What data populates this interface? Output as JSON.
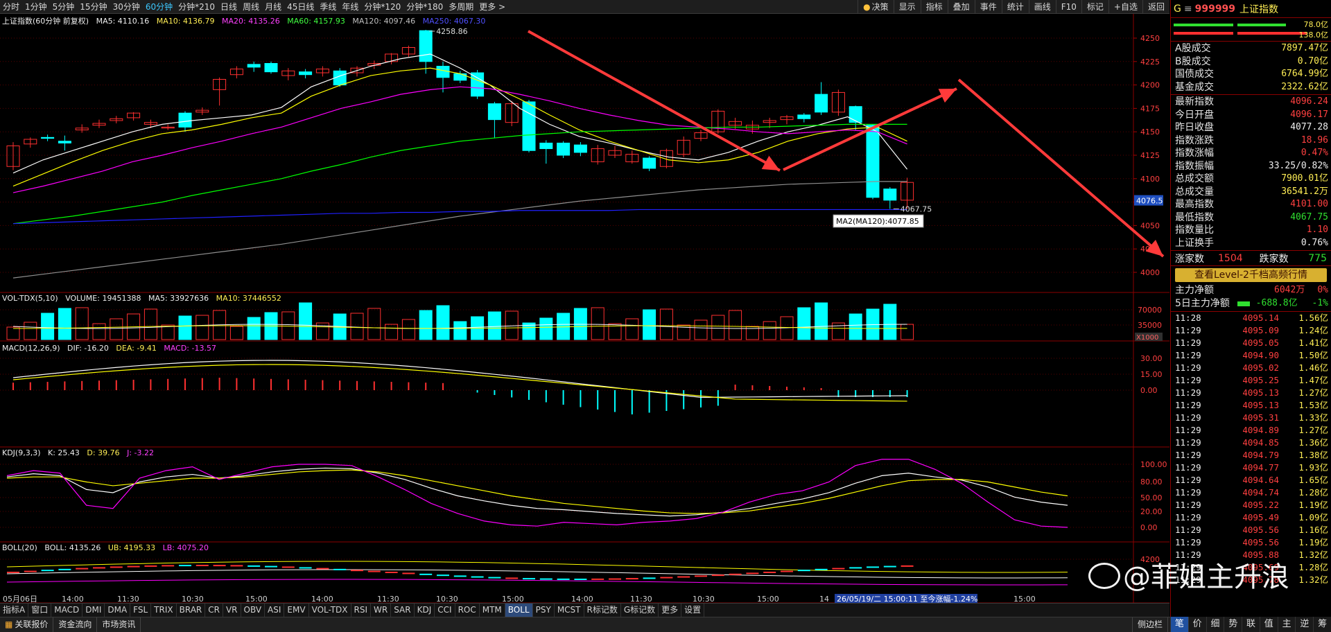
{
  "toolbar": {
    "periods": [
      "分时",
      "1分钟",
      "5分钟",
      "15分钟",
      "30分钟",
      "60分钟",
      "分钟*210",
      "日线",
      "周线",
      "月线",
      "45日线",
      "季线",
      "年线",
      "分钟*120",
      "分钟*180",
      "多周期",
      "更多 >"
    ],
    "active_period": "60分钟",
    "buttons": [
      "决策",
      "显示",
      "指标",
      "叠加",
      "事件",
      "统计",
      "画线",
      "F10",
      "标记",
      "+自选",
      "返回"
    ]
  },
  "main_panel": {
    "title": "上证指数(60分钟 前复权)",
    "ma5": "MA5: 4110.16",
    "ma10": "MA10: 4136.79",
    "ma20": "MA20: 4135.26",
    "ma60": "MA60: 4157.93",
    "ma120": "MA120: 4097.46",
    "ma250": "MA250: 4067.30",
    "high_mark": "4258.86",
    "low_mark": "4067.75",
    "tooltip": "MA2(MA120):4077.85",
    "cursor_price": "4076.5",
    "y_ticks": [
      "4250",
      "4225",
      "4200",
      "4175",
      "4150",
      "4125",
      "4100",
      "4075",
      "4050",
      "4025",
      "4000"
    ]
  },
  "vol_panel": {
    "title": "VOL-TDX(5,10)",
    "volume": "VOLUME: 19451388",
    "ma5": "MA5: 33927636",
    "ma10": "MA10: 37446552",
    "y_ticks": [
      "70000",
      "35000"
    ],
    "unit": "X1000"
  },
  "macd_panel": {
    "title": "MACD(12,26,9)",
    "dif": "DIF: -16.20",
    "dea": "DEA: -9.41",
    "macd": "MACD: -13.57",
    "y_ticks": [
      "30.00",
      "15.00",
      "0.00"
    ]
  },
  "kdj_panel": {
    "title": "KDJ(9,3,3)",
    "k": "K: 25.43",
    "d": "D: 39.76",
    "j": "J: -3.22",
    "y_ticks": [
      "100.00",
      "80.00",
      "50.00",
      "20.00",
      "0.00"
    ]
  },
  "boll_panel": {
    "title": "BOLL(20)",
    "boll": "BOLL: 4135.26",
    "ub": "UB: 4195.33",
    "lb": "LB: 4075.20",
    "y_ticks": [
      "4200"
    ]
  },
  "x_axis": {
    "labels": [
      "05月06日",
      "14:00",
      "11:30",
      "10:30",
      "15:00",
      "14:00",
      "11:30",
      "10:30",
      "15:00",
      "14:00",
      "11:30",
      "10:30",
      "15:00",
      "14"
    ],
    "cursor_info": "26/05/19/二 15:00:11 至今涨幅-1.24%",
    "last_label": "15:00"
  },
  "indicators": [
    "指标A",
    "窗口",
    "MACD",
    "DMI",
    "DMA",
    "FSL",
    "TRIX",
    "BRAR",
    "CR",
    "VR",
    "OBV",
    "ASI",
    "EMV",
    "VOL-TDX",
    "RSI",
    "WR",
    "SAR",
    "KDJ",
    "CCI",
    "ROC",
    "MTM",
    "BOLL",
    "PSY",
    "MCST",
    "R标记数",
    "G标记数",
    "更多",
    "设置"
  ],
  "active_indicator": "BOLL",
  "status_bar": [
    "关联报价",
    "资金流向",
    "市场资讯"
  ],
  "side_label": "侧边栏",
  "right_panel": {
    "code": "999999",
    "name": "上证指数",
    "marker": "G",
    "bar_top": "78.0亿",
    "bar_bottom": "138.0亿",
    "turnover": [
      {
        "k": "A股成交",
        "v": "7897.47亿"
      },
      {
        "k": "B股成交",
        "v": "0.70亿"
      },
      {
        "k": "国债成交",
        "v": "6764.99亿"
      },
      {
        "k": "基金成交",
        "v": "2322.62亿"
      }
    ],
    "stats": [
      {
        "k": "最新指数",
        "v": "4096.24",
        "c": "red"
      },
      {
        "k": "今日开盘",
        "v": "4096.17",
        "c": "red"
      },
      {
        "k": "昨日收盘",
        "v": "4077.28",
        "c": "white"
      },
      {
        "k": "指数涨跌",
        "v": "18.96",
        "c": "red"
      },
      {
        "k": "指数涨幅",
        "v": "0.47%",
        "c": "red"
      },
      {
        "k": "指数振幅",
        "v": "33.25/0.82%",
        "c": "white"
      },
      {
        "k": "总成交额",
        "v": "7900.01亿",
        "c": "yellow"
      },
      {
        "k": "总成交量",
        "v": "36541.2万",
        "c": "yellow"
      },
      {
        "k": "最高指数",
        "v": "4101.00",
        "c": "red"
      },
      {
        "k": "最低指数",
        "v": "4067.75",
        "c": "green"
      },
      {
        "k": "指数量比",
        "v": "1.10",
        "c": "red"
      },
      {
        "k": "上证换手",
        "v": "0.76%",
        "c": "white"
      }
    ],
    "rise_label": "涨家数",
    "rise_value": "1504",
    "fall_label": "跌家数",
    "fall_value": "775",
    "level2": "查看Level-2千档高频行情",
    "main_net_label": "主力净额",
    "main_net_value": "6042万",
    "main_net_pct": "0%",
    "five_day_label": "5日主力净额",
    "five_day_value": "-688.8亿",
    "five_day_pct": "-1%",
    "ticks": [
      {
        "t": "11:28",
        "p": "4095.14",
        "a": "1.56亿"
      },
      {
        "t": "11:29",
        "p": "4095.09",
        "a": "1.24亿"
      },
      {
        "t": "11:29",
        "p": "4095.05",
        "a": "1.41亿"
      },
      {
        "t": "11:29",
        "p": "4094.90",
        "a": "1.50亿"
      },
      {
        "t": "11:29",
        "p": "4095.02",
        "a": "1.46亿"
      },
      {
        "t": "11:29",
        "p": "4095.25",
        "a": "1.47亿"
      },
      {
        "t": "11:29",
        "p": "4095.13",
        "a": "1.27亿"
      },
      {
        "t": "11:29",
        "p": "4095.13",
        "a": "1.53亿"
      },
      {
        "t": "11:29",
        "p": "4095.31",
        "a": "1.33亿"
      },
      {
        "t": "11:29",
        "p": "4094.89",
        "a": "1.27亿"
      },
      {
        "t": "11:29",
        "p": "4094.85",
        "a": "1.36亿"
      },
      {
        "t": "11:29",
        "p": "4094.79",
        "a": "1.38亿"
      },
      {
        "t": "11:29",
        "p": "4094.77",
        "a": "1.93亿"
      },
      {
        "t": "11:29",
        "p": "4094.64",
        "a": "1.65亿"
      },
      {
        "t": "11:29",
        "p": "4094.74",
        "a": "1.28亿"
      },
      {
        "t": "11:29",
        "p": "4095.22",
        "a": "1.19亿"
      },
      {
        "t": "11:29",
        "p": "4095.49",
        "a": "1.09亿"
      },
      {
        "t": "11:29",
        "p": "4095.56",
        "a": "1.16亿"
      },
      {
        "t": "11:29",
        "p": "4095.56",
        "a": "1.19亿"
      },
      {
        "t": "11:29",
        "p": "4095.88",
        "a": "1.32亿"
      },
      {
        "t": "11:29",
        "p": "4095.69",
        "a": "1.28亿"
      },
      {
        "t": "11:29",
        "p": "4095.78",
        "a": "1.32亿"
      }
    ],
    "tabs": [
      "笔",
      "价",
      "细",
      "势",
      "联",
      "值",
      "主",
      "逆",
      "筹"
    ]
  },
  "watermark": "@菲姐主升浪",
  "colors": {
    "up": "#ff3030",
    "down": "#00ffff",
    "ma5": "#ffffff",
    "ma10": "#ffff00",
    "ma20": "#ff00ff",
    "ma60": "#00ff00",
    "ma120": "#909090",
    "ma250": "#2020ff",
    "arrow": "#ff3a3a"
  }
}
